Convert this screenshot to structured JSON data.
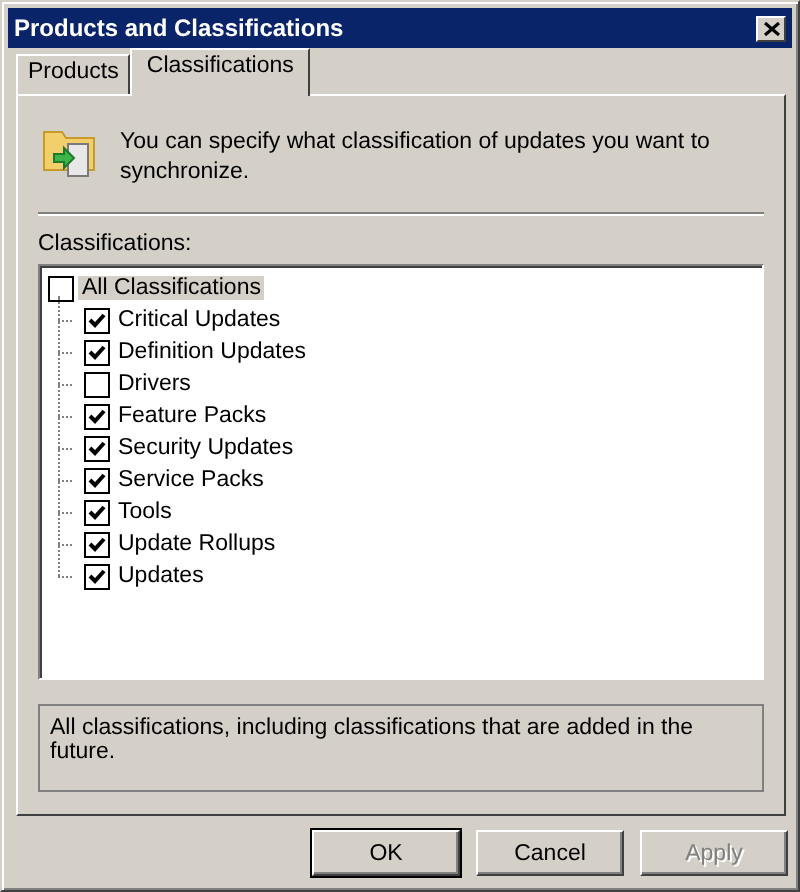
{
  "window": {
    "title": "Products and Classifications"
  },
  "tabs": [
    {
      "label": "Products",
      "selected": false
    },
    {
      "label": "Classifications",
      "selected": true
    }
  ],
  "intro": "You can specify what classification of updates you want to synchronize.",
  "classifications_label": "Classifications:",
  "tree": {
    "label": "All Classifications",
    "checked": false,
    "selected": true,
    "children": [
      {
        "label": "Critical Updates",
        "checked": true,
        "selected": false
      },
      {
        "label": "Definition Updates",
        "checked": true,
        "selected": false
      },
      {
        "label": "Drivers",
        "checked": false,
        "selected": false
      },
      {
        "label": "Feature Packs",
        "checked": true,
        "selected": false
      },
      {
        "label": "Security Updates",
        "checked": true,
        "selected": false
      },
      {
        "label": "Service Packs",
        "checked": true,
        "selected": false
      },
      {
        "label": "Tools",
        "checked": true,
        "selected": false
      },
      {
        "label": "Update Rollups",
        "checked": true,
        "selected": false
      },
      {
        "label": "Updates",
        "checked": true,
        "selected": false
      }
    ]
  },
  "description": "All classifications, including classifications that are added in the future.",
  "buttons": [
    {
      "label": "OK",
      "default": true,
      "disabled": false
    },
    {
      "label": "Cancel",
      "default": false,
      "disabled": false
    },
    {
      "label": "Apply",
      "default": false,
      "disabled": true
    }
  ]
}
